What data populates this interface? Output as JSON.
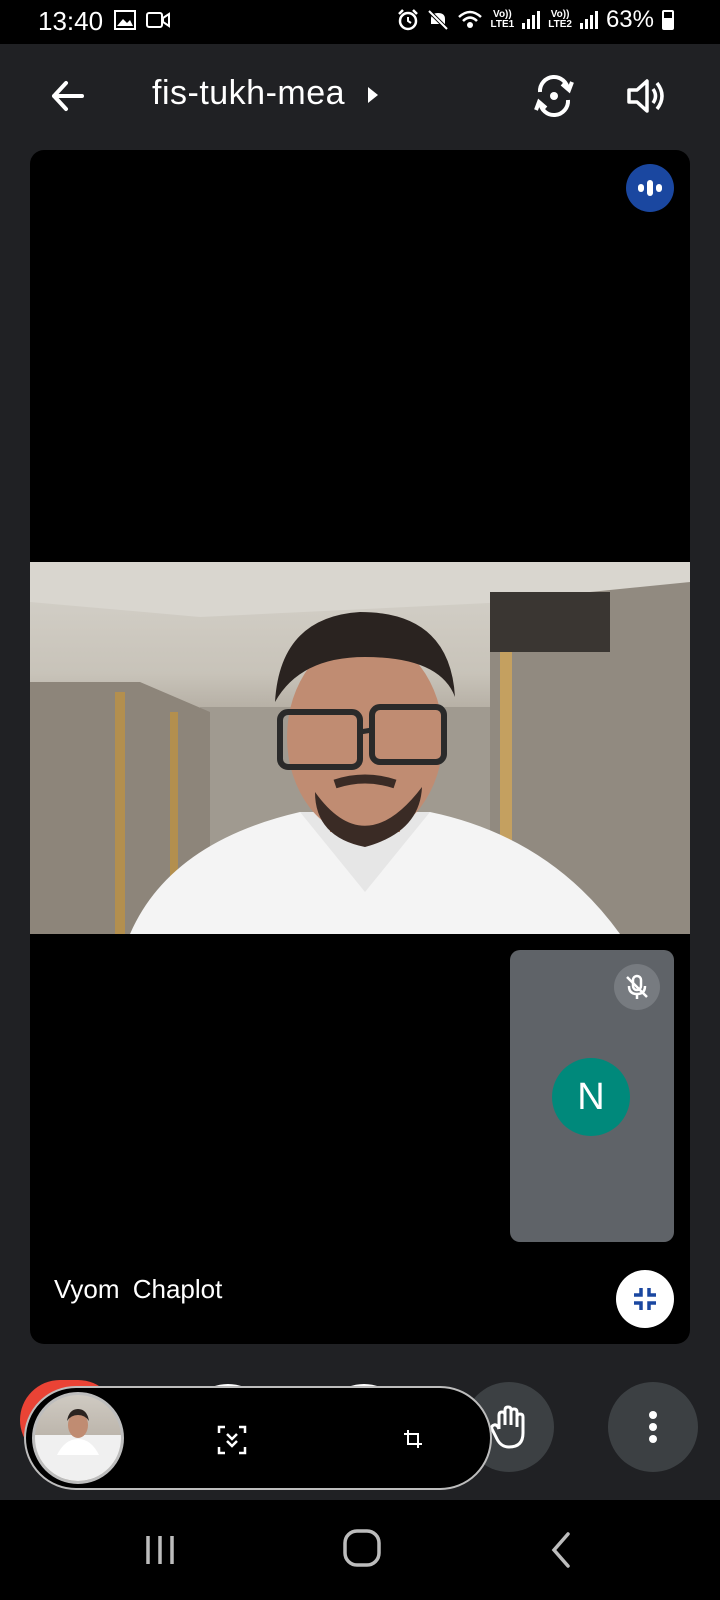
{
  "status_bar": {
    "time": "13:40",
    "battery_text": "63%",
    "sim1_label": "Vo))\nLTE1",
    "sim2_label": "Vo))\nLTE2"
  },
  "header": {
    "meeting_code": "fis-tukh-mea"
  },
  "stage": {
    "participant_name": "Vyom  Chaplot",
    "self_avatar_initial": "N"
  },
  "colors": {
    "end_call": "#ea4335",
    "speaking_indicator": "#1a47a0",
    "avatar": "#00897b",
    "tile_bg": "#5f6368"
  },
  "icons": {
    "back": "arrow-left-icon",
    "switch_camera": "switch-camera-icon",
    "speaker": "speaker-icon",
    "speaking": "audio-level-icon",
    "muted": "mic-off-icon",
    "fullscreen_exit": "collapse-icon",
    "raise_hand": "hand-icon",
    "more": "more-vert-icon"
  }
}
